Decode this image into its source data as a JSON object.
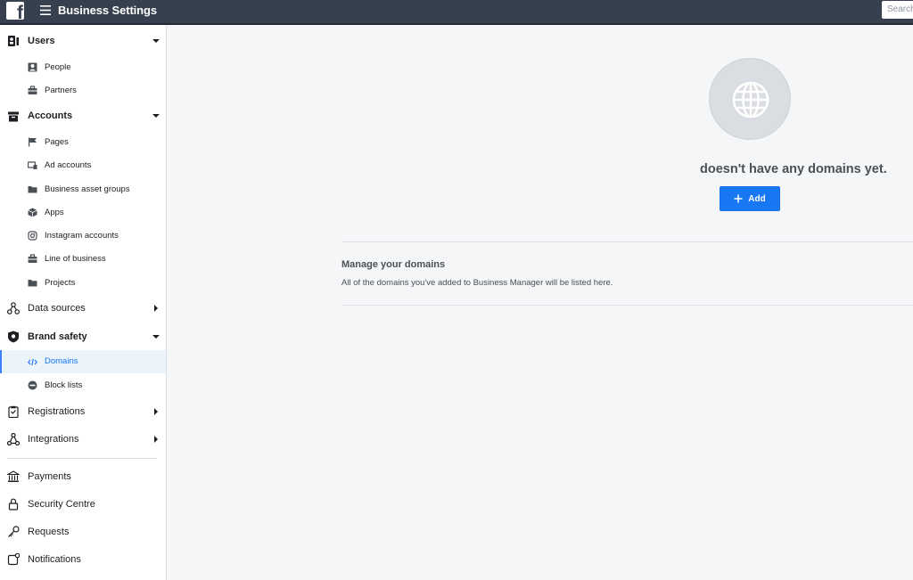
{
  "topbar": {
    "logo_glyph": "f",
    "title": "Business Settings",
    "search_placeholder": "Search"
  },
  "sidebar": {
    "sections": [
      {
        "label": "Users",
        "icon": "users-icon",
        "expanded": true,
        "items": [
          {
            "label": "People",
            "icon": "person-icon"
          },
          {
            "label": "Partners",
            "icon": "briefcase-icon"
          }
        ]
      },
      {
        "label": "Accounts",
        "icon": "accounts-icon",
        "expanded": true,
        "items": [
          {
            "label": "Pages",
            "icon": "flag-icon"
          },
          {
            "label": "Ad accounts",
            "icon": "ad-account-icon"
          },
          {
            "label": "Business asset groups",
            "icon": "folder-icon"
          },
          {
            "label": "Apps",
            "icon": "cube-icon"
          },
          {
            "label": "Instagram accounts",
            "icon": "instagram-icon"
          },
          {
            "label": "Line of business",
            "icon": "briefcase-icon"
          },
          {
            "label": "Projects",
            "icon": "folder-icon"
          }
        ]
      },
      {
        "label": "Data sources",
        "icon": "data-sources-icon",
        "expanded": false
      },
      {
        "label": "Brand safety",
        "icon": "shield-icon",
        "expanded": true,
        "items": [
          {
            "label": "Domains",
            "icon": "code-icon",
            "active": true
          },
          {
            "label": "Block lists",
            "icon": "block-icon"
          }
        ]
      },
      {
        "label": "Registrations",
        "icon": "clipboard-icon",
        "expanded": false
      },
      {
        "label": "Integrations",
        "icon": "integrations-icon",
        "expanded": false
      },
      {
        "label": "Payments",
        "icon": "bank-icon"
      },
      {
        "label": "Security Centre",
        "icon": "lock-icon"
      },
      {
        "label": "Requests",
        "icon": "key-icon"
      },
      {
        "label": "Notifications",
        "icon": "notification-icon"
      }
    ]
  },
  "main": {
    "empty_state": {
      "icon": "globe-icon",
      "message": "doesn't have any domains yet.",
      "add_label": "Add"
    },
    "manage": {
      "title": "Manage your domains",
      "description": "All of the domains you've added to Business Manager will be listed here."
    }
  },
  "colors": {
    "topbar": "#36404f",
    "accent": "#1877f2",
    "active_bg": "#ebf3fb",
    "active_text": "#1877f2"
  }
}
